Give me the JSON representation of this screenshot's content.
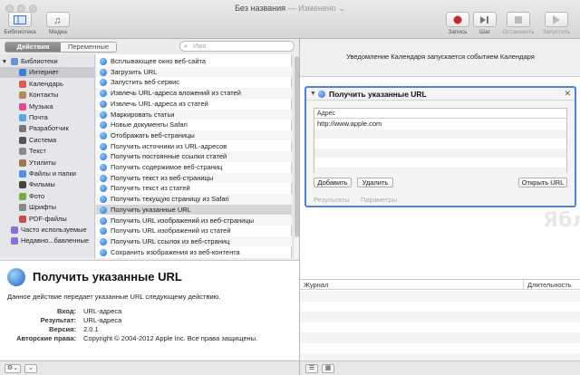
{
  "window": {
    "title": "Без названия",
    "status": "— Изменено ⌄"
  },
  "toolbar": {
    "library_label": "Библиотека",
    "media_label": "Медиа",
    "record_label": "Запись",
    "step_label": "Шаг",
    "stop_label": "Остановить",
    "run_label": "Запустить"
  },
  "tabs": {
    "actions": "Действия",
    "variables": "Переменные"
  },
  "search": {
    "placeholder": "Имя"
  },
  "categories": [
    {
      "label": "Библиотеки",
      "icon": "folder-icon",
      "color": "#6b8fd6"
    },
    {
      "label": "Интернет",
      "icon": "globe-icon",
      "color": "#3a7fd6"
    },
    {
      "label": "Календарь",
      "icon": "calendar-icon",
      "color": "#e05a4a"
    },
    {
      "label": "Контакты",
      "icon": "contacts-icon",
      "color": "#b08a5a"
    },
    {
      "label": "Музыка",
      "icon": "music-icon",
      "color": "#e14b8f"
    },
    {
      "label": "Почта",
      "icon": "mail-icon",
      "color": "#5fa3e0"
    },
    {
      "label": "Разработчик",
      "icon": "hammer-icon",
      "color": "#777777"
    },
    {
      "label": "Система",
      "icon": "system-icon",
      "color": "#555555"
    },
    {
      "label": "Текст",
      "icon": "text-icon",
      "color": "#8a8a8a"
    },
    {
      "label": "Утилиты",
      "icon": "utilities-icon",
      "color": "#9a7b4f"
    },
    {
      "label": "Файлы и папки",
      "icon": "finder-icon",
      "color": "#4f91e0"
    },
    {
      "label": "Фильмы",
      "icon": "film-icon",
      "color": "#444444"
    },
    {
      "label": "Фото",
      "icon": "photo-icon",
      "color": "#6fae4a"
    },
    {
      "label": "Шрифты",
      "icon": "font-icon",
      "color": "#888888"
    },
    {
      "label": "PDF-файлы",
      "icon": "pdf-icon",
      "color": "#c94a4a"
    },
    {
      "label": "Часто используемые",
      "icon": "smart-folder-icon",
      "color": "#8a6fd6"
    },
    {
      "label": "Недавно...бавленные",
      "icon": "smart-folder-icon",
      "color": "#8a6fd6"
    }
  ],
  "actions": [
    "Всплывающее окно веб-сайта",
    "Загрузить URL",
    "Запустить веб-сервис",
    "Извлечь URL-адреса вложений из статей",
    "Извлечь URL-адреса из статей",
    "Маркировать статьи",
    "Новые документы Safari",
    "Отображать веб-страницы",
    "Получить источники из URL-адресов",
    "Получить постоянные ссылки статей",
    "Получить содержимое веб-страниц",
    "Получить текст из веб-страницы",
    "Получить текст из статей",
    "Получить текущую страницу из Safari",
    "Получить указанные URL",
    "Получить URL изображений из веб-страницы",
    "Получить URL изображений из статей",
    "Получить URL ссылок из веб-страниц",
    "Сохранить изображения из веб-контента"
  ],
  "description": {
    "title": "Получить указанные URL",
    "text": "Данное действие передает указанные URL следующему действию.",
    "input_key": "Вход:",
    "input_val": "URL-адреса",
    "result_key": "Результат:",
    "result_val": "URL-адреса",
    "version_key": "Версия:",
    "version_val": "2.0.1",
    "copyright_key": "Авторские права:",
    "copyright_val": "Copyright © 2004-2012 Apple Inc. Все права защищены."
  },
  "workflow": {
    "banner": "Уведомление Календаря запускается событием Календаря",
    "card_title": "Получить указанные URL",
    "column_header": "Адрес",
    "urls": [
      "http://www.apple.com"
    ],
    "add_label": "Добавить",
    "delete_label": "Удалить",
    "open_label": "Открыть URL",
    "results_tab": "Результаты",
    "options_tab": "Параметры"
  },
  "log": {
    "col_log": "Журнал",
    "col_duration": "Длительность"
  },
  "watermark": "Яблык",
  "colors": {
    "accent": "#4a86d8",
    "record": "#c62828"
  }
}
